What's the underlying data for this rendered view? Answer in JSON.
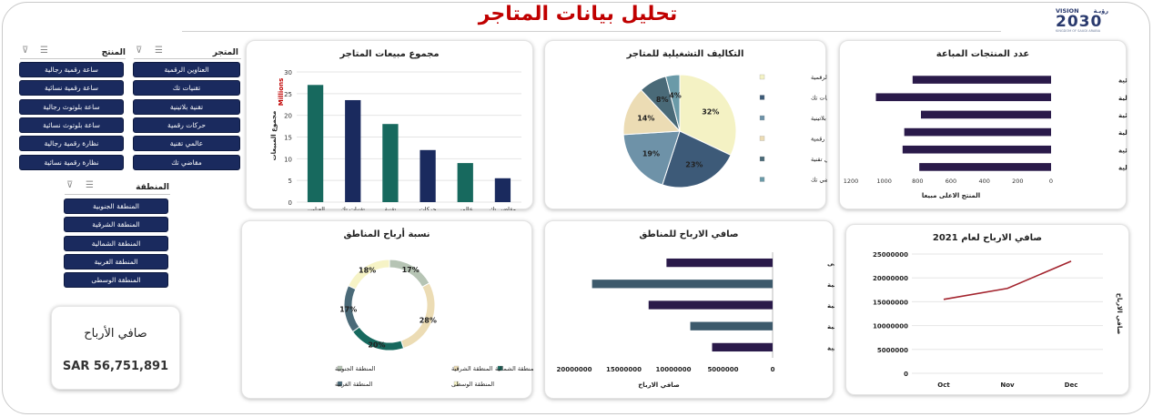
{
  "header": {
    "title": "تحليل بيانات المتاجر",
    "logo_vision": "VISION",
    "logo_arabic": "رؤيـة",
    "logo_year": "2030",
    "logo_sub": "KINGDOM OF SAUDI ARABIA"
  },
  "slicers": {
    "store": {
      "label": "المتجر",
      "items": [
        "العناوين الرقمية",
        "تقنيات تك",
        "تقنية بلاتينية",
        "حركات رقمية",
        "عالمي تقنية",
        "مقاضي تك"
      ]
    },
    "product": {
      "label": "المنتج",
      "items": [
        "ساعة رقمية رجالية",
        "ساعة رقمية نسائية",
        "ساعة بلوتوث رجالية",
        "ساعة بلوتوث نسائية",
        "نظارة رقمية رجالية",
        "نظارة رقمية نسائية"
      ]
    },
    "region": {
      "label": "المنطقة",
      "items": [
        "المنطقة الجنوبية",
        "المنطقة الشرقية",
        "المنطقة الشمالية",
        "المنطقة الغربية",
        "المنطقة الوسطى"
      ]
    }
  },
  "kpi": {
    "label": "صافي الأرباح",
    "value": "SAR 56,751,891"
  },
  "colors": {
    "title": "#c00000",
    "navy": "#1a2a5e",
    "teal": "#17695e",
    "purple": "#2a1a4a",
    "slate": "#3d5a6c",
    "crimson": "#a3242e"
  },
  "chart_data": [
    {
      "id": "store_sales",
      "type": "bar",
      "title": "مجموع مبيعات المتاجر",
      "xlabel": "المتاجر",
      "ylabel": "مجموع المبيعات",
      "yunit": "Millions",
      "categories": [
        "العناوين الرقمية",
        "تقنيات تك",
        "تقنية بلاتينية",
        "حركات رقمية",
        "عالمي تقنية",
        "مقاضي تك"
      ],
      "values": [
        27,
        23.5,
        18,
        12,
        9,
        5.5
      ],
      "ylim": [
        0,
        30
      ],
      "yticks": [
        0,
        5,
        10,
        15,
        20,
        25,
        30
      ],
      "colors": [
        "#17695e",
        "#1a2a5e",
        "#17695e",
        "#1a2a5e",
        "#17695e",
        "#1a2a5e"
      ],
      "grid": true
    },
    {
      "id": "operating_costs",
      "type": "pie",
      "title": "التكاليف التشغيلية للمتاجر",
      "labels": [
        "العناوين الرقمية",
        "تقنيات تك",
        "تقنية بلاتينية",
        "حركات رقمية",
        "عالمي تقنية",
        "مقاضي تك"
      ],
      "values": [
        32,
        23,
        19,
        14,
        8,
        4
      ],
      "value_labels": [
        "32%",
        "23%",
        "19%",
        "14%",
        "8%",
        "4%"
      ],
      "colors": [
        "#f4f2c4",
        "#3d5a78",
        "#6e92a8",
        "#ecdcb4",
        "#4a6a78",
        "#6a9aa8"
      ],
      "legend": "right"
    },
    {
      "id": "products_sold",
      "type": "bar",
      "orientation": "horizontal",
      "title": "عدد المنتجات المباعة",
      "xlabel": "المنتج الاعلى مبيعا",
      "categories": [
        "نظارة رقمية نسائية",
        "نظارة رقمية رجالية",
        "ساعة بلوتوث نسائية",
        "ساعة بلوتوث رجالية",
        "ساعة رقمية نسائية",
        "ساعة رقمية رجالية"
      ],
      "values": [
        830,
        1050,
        780,
        880,
        890,
        790
      ],
      "xlim": [
        0,
        1200
      ],
      "xticks": [
        0,
        200,
        400,
        600,
        800,
        1000,
        1200
      ],
      "color": "#2a1a4a"
    },
    {
      "id": "region_share",
      "type": "pie",
      "donut": true,
      "title": "نسبة أرباح المناطق",
      "labels": [
        "المنطقة الجنوبية",
        "المنطقة الشرقية",
        "المنطقة الشمالية",
        "المنطقة الغربية",
        "المنطقة الوسطى"
      ],
      "values": [
        17,
        28,
        20,
        17,
        18
      ],
      "value_labels": [
        "17%",
        "28%",
        "20%",
        "17%",
        "18%"
      ],
      "colors": [
        "#b6c4b4",
        "#ecdcb4",
        "#17695e",
        "#4a6a78",
        "#f6f3c6"
      ],
      "legend": "bottom"
    },
    {
      "id": "region_profit",
      "type": "bar",
      "orientation": "horizontal",
      "title": "صافي الارباح للمناطق",
      "xlabel": "صافي الارباح",
      "categories": [
        "المنطقة الوسطى",
        "المنطقة الغربية",
        "المنطقة الشمالية",
        "المنطقة الشرقية",
        "المنطقة الجنوبية"
      ],
      "values": [
        10700000,
        18200000,
        12500000,
        8300000,
        6100000
      ],
      "xlim": [
        0,
        20000000
      ],
      "xticks": [
        0,
        5000000,
        10000000,
        15000000,
        20000000
      ],
      "colors": [
        "#2a1a4a",
        "#3d5a6c",
        "#2a1a4a",
        "#3d5a6c",
        "#2a1a4a"
      ]
    },
    {
      "id": "profit_2021",
      "type": "line",
      "title": "صافي الارباح لعام 2021",
      "ylabel": "صافي الارباح",
      "x": [
        "Oct",
        "Nov",
        "Dec"
      ],
      "values": [
        15500000,
        17800000,
        23500000
      ],
      "ylim": [
        0,
        25000000
      ],
      "yticks": [
        0,
        5000000,
        10000000,
        15000000,
        20000000,
        25000000
      ],
      "color": "#a3242e"
    }
  ]
}
